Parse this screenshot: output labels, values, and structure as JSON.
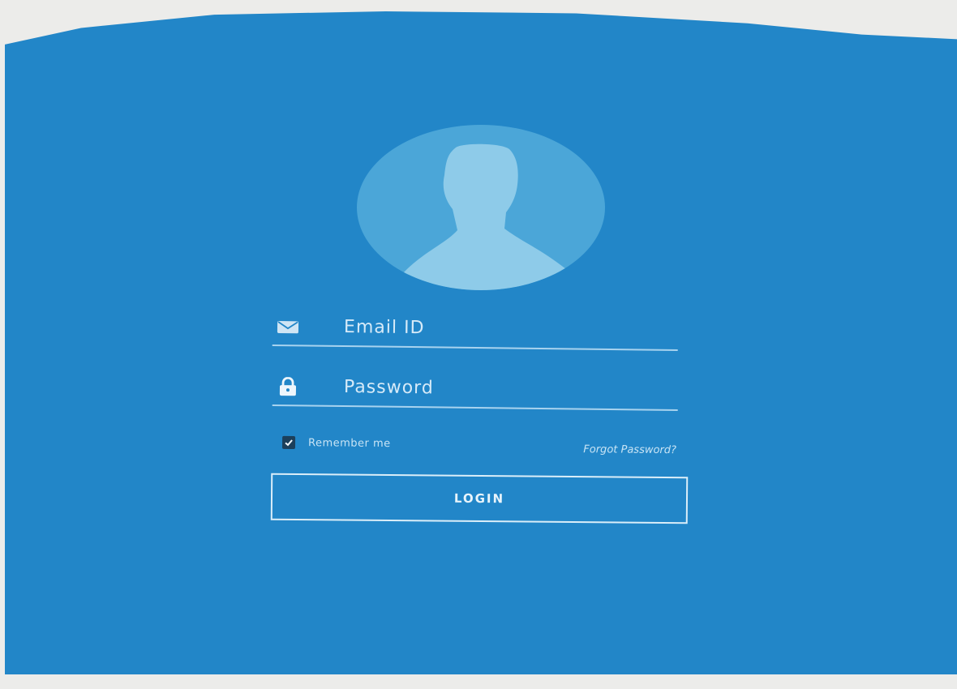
{
  "login_form": {
    "email_placeholder": "Email ID",
    "password_placeholder": "Password",
    "remember_label": "Remember me",
    "remember_checked": true,
    "forgot_label": "Forgot Password?",
    "login_label": "LOGIN"
  },
  "icons": {
    "avatar": "user-silhouette-icon",
    "email": "envelope-icon",
    "password": "lock-icon",
    "checkbox": "checkmark-icon"
  },
  "colors": {
    "background": "#2286c8",
    "avatar_circle": "#4ba6d8",
    "avatar_silhouette": "#8ecbe9",
    "text": "#dfeef9",
    "underline": "#a8d3ef"
  }
}
